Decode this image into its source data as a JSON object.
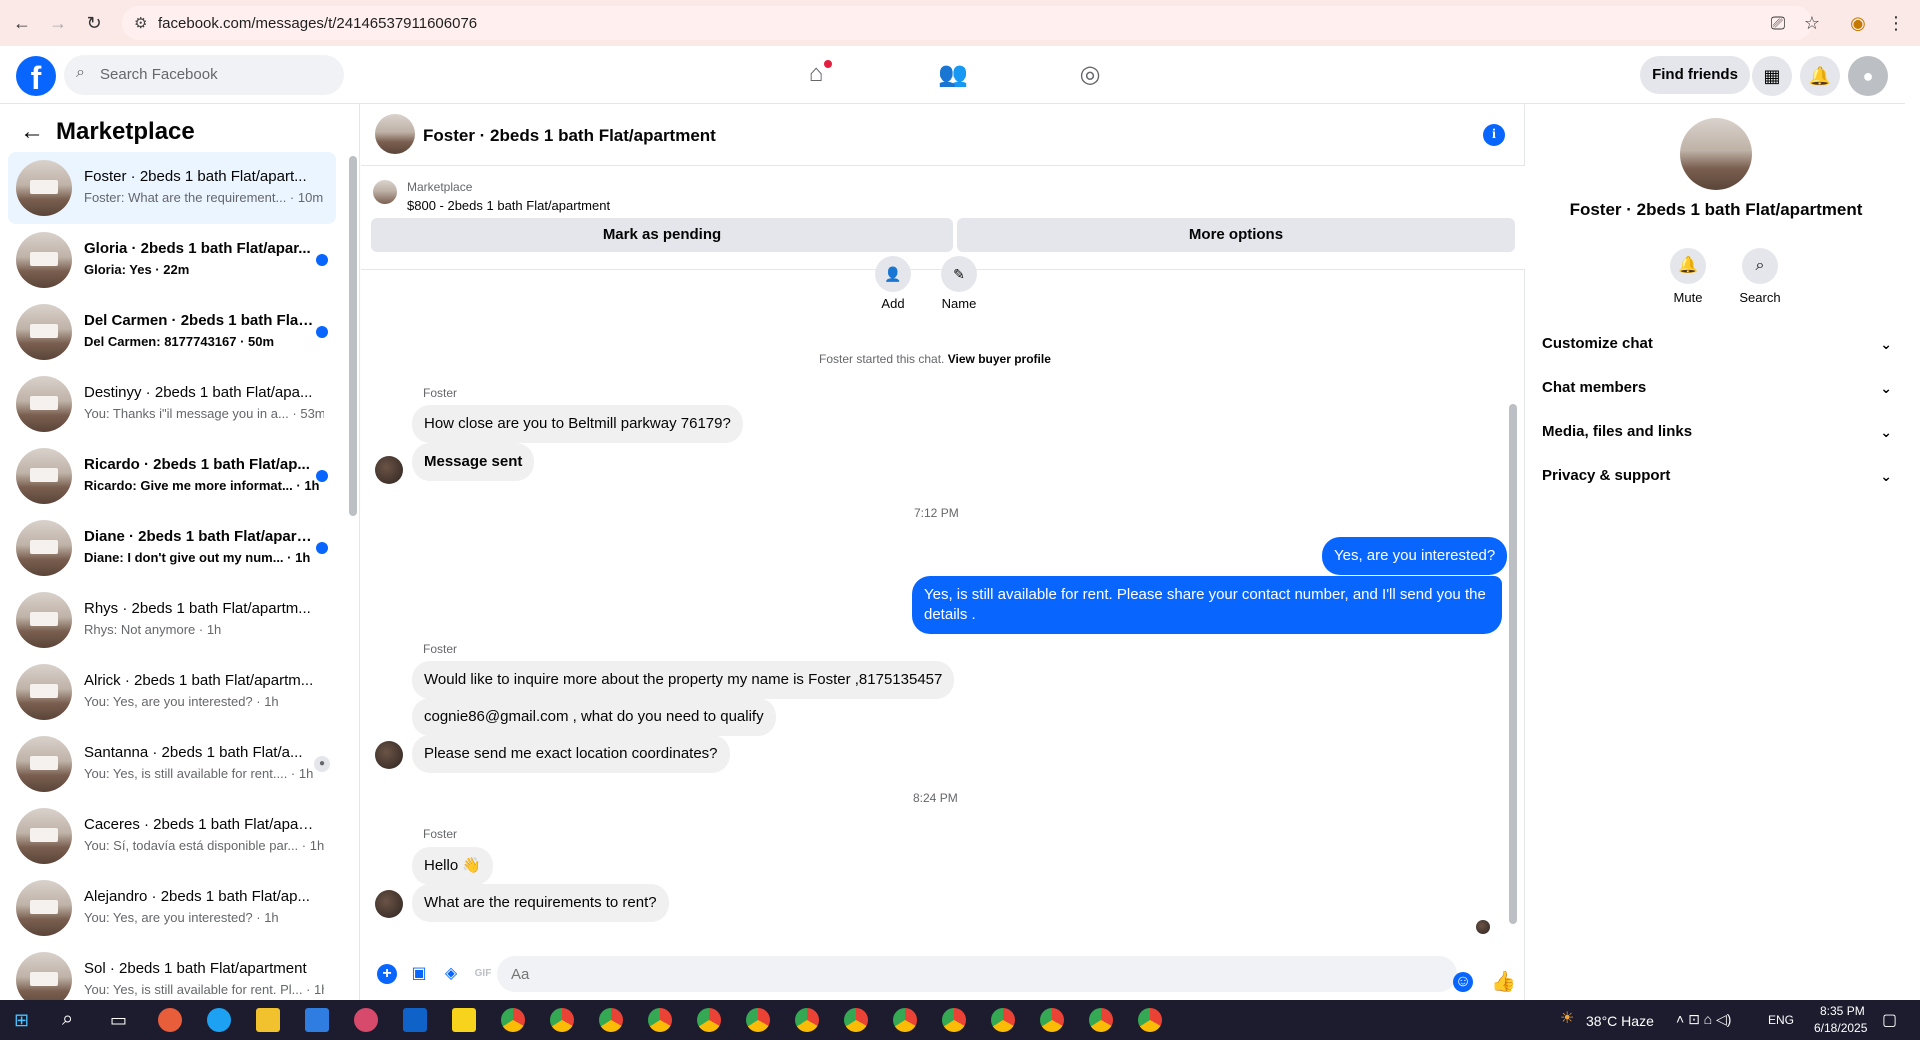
{
  "browser": {
    "url": "facebook.com/messages/t/24146537911606076"
  },
  "fb": {
    "search_placeholder": "Search Facebook",
    "find_friends": "Find friends"
  },
  "sidebar": {
    "title": "Marketplace",
    "conversations": [
      {
        "name": "Foster · 2beds 1 bath Flat/apart...",
        "snippet": "Foster: What are the requirement... · 10m",
        "active": true,
        "unread": false
      },
      {
        "name": "Gloria · 2beds 1 bath Flat/apar...",
        "snippet": "Gloria: Yes · 22m",
        "unread": true
      },
      {
        "name": "Del Carmen · 2beds 1 bath Flat...",
        "snippet": "Del Carmen: 8177743167 · 50m",
        "unread": true
      },
      {
        "name": "Destinyy · 2beds 1 bath Flat/apa...",
        "snippet": "You: Thanks i\"il message you in a... · 53m",
        "unread": false
      },
      {
        "name": "Ricardo · 2beds 1 bath Flat/ap...",
        "snippet": "Ricardo: Give me more informat... · 1h",
        "unread": true
      },
      {
        "name": "Diane · 2beds 1 bath Flat/apart...",
        "snippet": "Diane: I don't give out my num... · 1h",
        "unread": true
      },
      {
        "name": "Rhys · 2beds 1 bath Flat/apartm...",
        "snippet": "Rhys: Not anymore · 1h",
        "unread": false
      },
      {
        "name": "Alrick · 2beds 1 bath Flat/apartm...",
        "snippet": "You: Yes, are you interested? · 1h",
        "unread": false
      },
      {
        "name": "Santanna · 2beds 1 bath Flat/a...",
        "snippet": "You: Yes, is still available for rent.... · 1h",
        "unread": false,
        "seen": true
      },
      {
        "name": "Caceres · 2beds 1 bath Flat/apar...",
        "snippet": "You: Sí, todavía está disponible par... · 1h",
        "unread": false
      },
      {
        "name": "Alejandro · 2beds 1 bath Flat/ap...",
        "snippet": "You: Yes, are you interested? · 1h",
        "unread": false
      },
      {
        "name": "Sol · 2beds 1 bath Flat/apartment",
        "snippet": "You: Yes, is still available for rent. Pl... · 1h",
        "unread": false
      }
    ]
  },
  "chat": {
    "title": "Foster · 2beds 1 bath Flat/apartment",
    "marketplace_label": "Marketplace",
    "listing": "$800 - 2beds 1 bath Flat/apartment",
    "mark_pending": "Mark as pending",
    "more_options": "More options",
    "add_label": "Add",
    "name_label": "Name",
    "started_text": "Foster started this chat.",
    "view_profile": "View buyer profile",
    "sender": "Foster",
    "messages": {
      "m1": "How close are you to Beltmill parkway 76179?",
      "m2": "Message sent",
      "ts1": "7:12 PM",
      "o1": "Yes, are you interested?",
      "o2a": "Yes, is still available for rent. Please share your contact number, and I'll send you the",
      "o2b": "details .",
      "m3": "Would like to inquire more about the property my name is Foster ,8175135457",
      "m4": "cognie86@gmail.com , what do you need to qualify",
      "m5": "Please send me exact location coordinates?",
      "ts2": "8:24 PM",
      "m6": "Hello 👋",
      "m7": "What are the requirements to rent?"
    },
    "input_placeholder": "Aa"
  },
  "right_panel": {
    "name": "Foster · 2beds 1 bath Flat/apartment",
    "mute": "Mute",
    "search": "Search",
    "sections": [
      "Customize chat",
      "Chat members",
      "Media, files and links",
      "Privacy & support"
    ]
  },
  "taskbar": {
    "weather": "38°C  Haze",
    "lang": "ENG",
    "time": "8:35 PM",
    "date": "6/18/2025"
  }
}
